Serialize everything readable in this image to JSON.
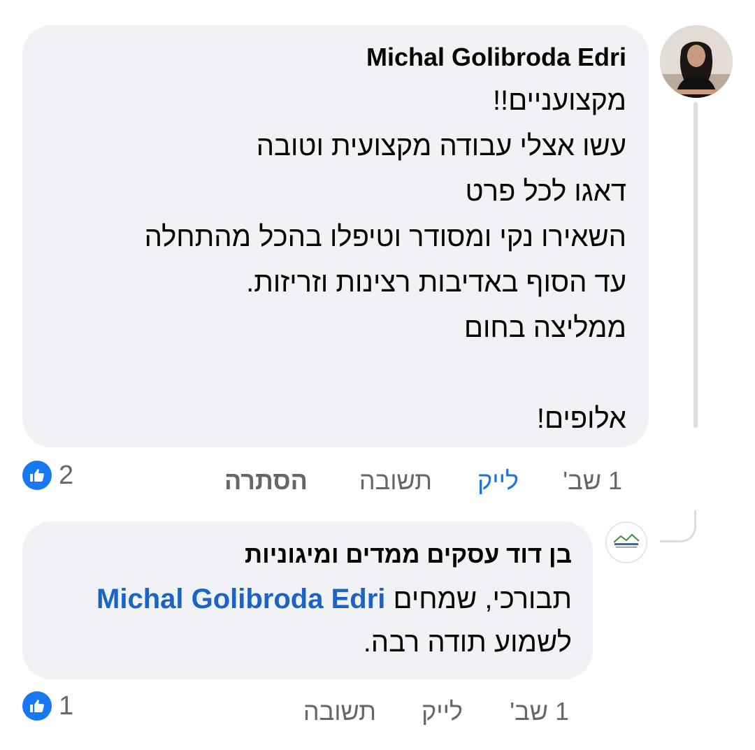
{
  "comments": [
    {
      "author": "Michal Golibroda Edri",
      "lines": [
        "מקצועניים!!",
        "עשו אצלי עבודה מקצועית וטובה",
        "דאגו לכל פרט",
        "השאירו נקי ומסודר וטיפלו בהכל מהתחלה",
        "עד הסוף באדיבות רצינות וזריזות.",
        "ממליצה בחום",
        "",
        "אלופים!"
      ],
      "time": "1 שב'",
      "like_label": "לייק",
      "reply_label": "תשובה",
      "hide_label": "הסתרה",
      "reaction_count": "2"
    },
    {
      "author": "בן דוד עסקים ממדים ומיגוניות",
      "body_prefix": "תבורכי, שמחים ",
      "mention": "Michal Golibroda Edri",
      "body_suffix": "לשמוע תודה רבה.",
      "time": "1 שב'",
      "like_label": "לייק",
      "reply_label": "תשובה",
      "reaction_count": "1"
    }
  ],
  "colors": {
    "bubble": "#f0f2f5",
    "meta_text": "#65676b",
    "link_blue": "#1b74e4",
    "like_icon_bg": "#1877f2",
    "thread_line": "#dadde1"
  },
  "icons": {
    "reaction": "thumbs-up-icon"
  }
}
